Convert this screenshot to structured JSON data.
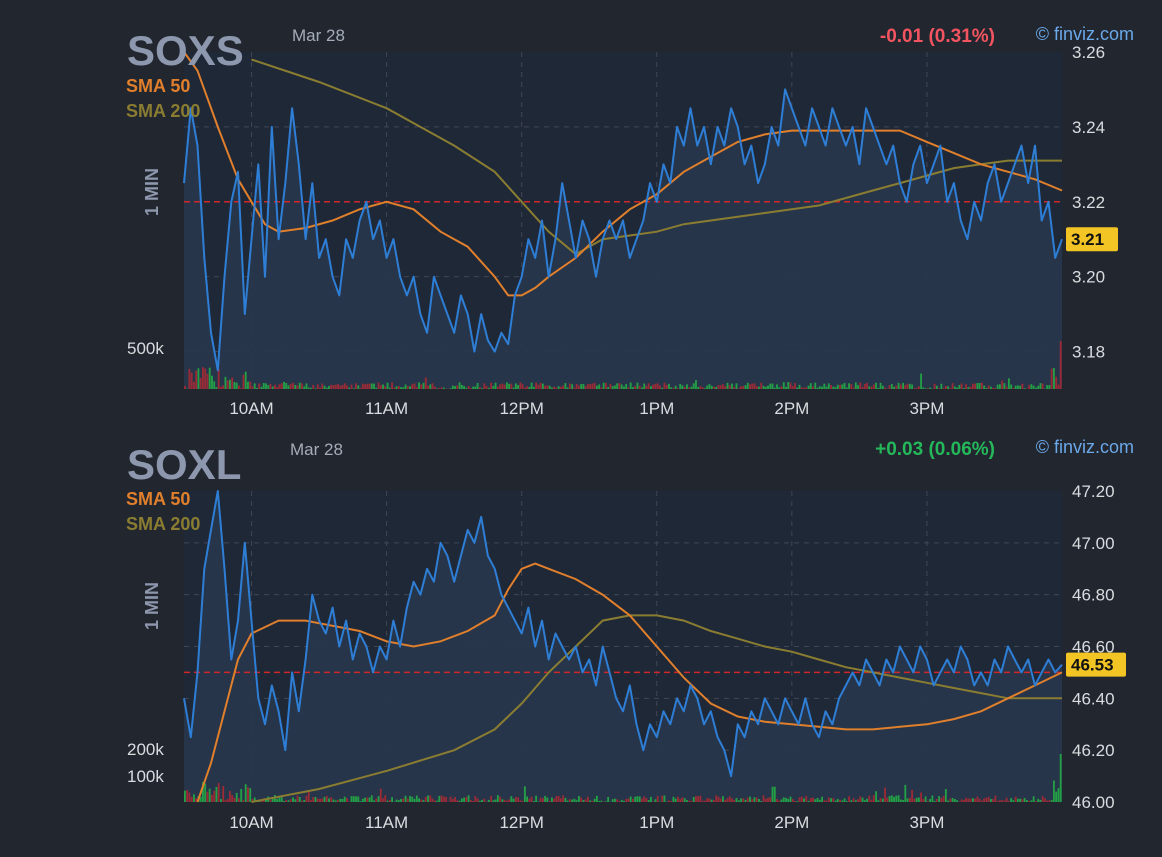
{
  "watermark": "© finviz.com",
  "colors": {
    "background": "#22262f",
    "plot_bg": "#1f2837",
    "price_line": "#2e7ed6",
    "price_fill": "#27364b",
    "sma50": "#e07f2c",
    "sma200": "#8a7d32",
    "prev_close": "#d0282a",
    "grid": "#414654",
    "axis_text": "#d9dcdf",
    "ticker_text": "#8d97ad",
    "vol_up": "#23a046",
    "vol_down": "#9a2b36",
    "change_down": "#f25460",
    "change_up": "#24b85a",
    "last_badge": "#f3c524"
  },
  "chart_data": [
    {
      "type": "line",
      "ticker": "SOXS",
      "date": "Mar 28",
      "timeframe": "1 MIN",
      "change": "-0.01 (0.31%)",
      "direction": "down",
      "legend": [
        "SMA 50",
        "SMA 200"
      ],
      "last_price": "3.21",
      "last_value": 3.21,
      "prev_close": 3.22,
      "ylim": [
        3.17,
        3.26
      ],
      "yticks": [
        3.18,
        3.2,
        3.22,
        3.24,
        3.26
      ],
      "ytick_labels": [
        "3.18",
        "3.20",
        "3.22",
        "3.24",
        "3.26"
      ],
      "x_range": [
        9.5,
        16.0
      ],
      "xticks": [
        10,
        11,
        12,
        13,
        14,
        15
      ],
      "xtick_labels": [
        "10AM",
        "11AM",
        "12PM",
        "1PM",
        "2PM",
        "3PM"
      ],
      "volume_label": "500k",
      "volume_label_value": 500,
      "volume_max": 620,
      "series": [
        {
          "name": "Price",
          "x": [
            9.5,
            9.55,
            9.6,
            9.65,
            9.7,
            9.75,
            9.8,
            9.85,
            9.9,
            9.95,
            10.0,
            10.05,
            10.1,
            10.15,
            10.2,
            10.25,
            10.3,
            10.35,
            10.4,
            10.45,
            10.5,
            10.55,
            10.6,
            10.65,
            10.7,
            10.75,
            10.8,
            10.85,
            10.9,
            10.95,
            11.0,
            11.05,
            11.1,
            11.15,
            11.2,
            11.25,
            11.3,
            11.35,
            11.4,
            11.45,
            11.5,
            11.55,
            11.6,
            11.65,
            11.7,
            11.75,
            11.8,
            11.85,
            11.9,
            11.95,
            12.0,
            12.05,
            12.1,
            12.15,
            12.2,
            12.25,
            12.3,
            12.35,
            12.4,
            12.45,
            12.5,
            12.55,
            12.6,
            12.65,
            12.7,
            12.75,
            12.8,
            12.85,
            12.9,
            12.95,
            13.0,
            13.05,
            13.1,
            13.15,
            13.2,
            13.25,
            13.3,
            13.35,
            13.4,
            13.45,
            13.5,
            13.55,
            13.6,
            13.65,
            13.7,
            13.75,
            13.8,
            13.85,
            13.9,
            13.95,
            14.0,
            14.05,
            14.1,
            14.15,
            14.2,
            14.25,
            14.3,
            14.35,
            14.4,
            14.45,
            14.5,
            14.55,
            14.6,
            14.65,
            14.7,
            14.75,
            14.8,
            14.85,
            14.9,
            14.95,
            15.0,
            15.05,
            15.1,
            15.15,
            15.2,
            15.25,
            15.3,
            15.35,
            15.4,
            15.45,
            15.5,
            15.55,
            15.6,
            15.65,
            15.7,
            15.75,
            15.8,
            15.85,
            15.9,
            15.95,
            16.0
          ],
          "values": [
            3.225,
            3.245,
            3.235,
            3.205,
            3.185,
            3.175,
            3.2,
            3.22,
            3.228,
            3.19,
            3.21,
            3.23,
            3.2,
            3.24,
            3.21,
            3.225,
            3.245,
            3.23,
            3.21,
            3.225,
            3.205,
            3.21,
            3.2,
            3.195,
            3.21,
            3.205,
            3.215,
            3.22,
            3.21,
            3.215,
            3.205,
            3.21,
            3.2,
            3.195,
            3.2,
            3.19,
            3.185,
            3.2,
            3.195,
            3.19,
            3.185,
            3.195,
            3.19,
            3.18,
            3.19,
            3.183,
            3.18,
            3.185,
            3.182,
            3.195,
            3.2,
            3.21,
            3.205,
            3.215,
            3.2,
            3.21,
            3.225,
            3.215,
            3.205,
            3.215,
            3.21,
            3.2,
            3.21,
            3.215,
            3.21,
            3.215,
            3.205,
            3.21,
            3.215,
            3.225,
            3.22,
            3.23,
            3.225,
            3.24,
            3.235,
            3.245,
            3.235,
            3.24,
            3.23,
            3.24,
            3.235,
            3.245,
            3.24,
            3.23,
            3.235,
            3.225,
            3.23,
            3.24,
            3.235,
            3.25,
            3.245,
            3.24,
            3.235,
            3.245,
            3.24,
            3.235,
            3.245,
            3.24,
            3.235,
            3.24,
            3.23,
            3.245,
            3.24,
            3.235,
            3.23,
            3.235,
            3.225,
            3.22,
            3.23,
            3.235,
            3.225,
            3.23,
            3.235,
            3.22,
            3.225,
            3.215,
            3.21,
            3.22,
            3.215,
            3.225,
            3.23,
            3.22,
            3.225,
            3.23,
            3.235,
            3.225,
            3.235,
            3.215,
            3.22,
            3.205,
            3.21
          ]
        },
        {
          "name": "SMA 50",
          "x": [
            9.5,
            9.6,
            9.75,
            9.9,
            10.0,
            10.1,
            10.2,
            10.4,
            10.6,
            10.8,
            11.0,
            11.2,
            11.4,
            11.6,
            11.8,
            11.9,
            12.0,
            12.1,
            12.2,
            12.4,
            12.6,
            12.8,
            13.0,
            13.2,
            13.4,
            13.6,
            13.8,
            14.0,
            14.2,
            14.4,
            14.6,
            14.8,
            15.0,
            15.2,
            15.4,
            15.6,
            15.8,
            16.0
          ],
          "values": [
            3.262,
            3.255,
            3.24,
            3.226,
            3.22,
            3.214,
            3.212,
            3.213,
            3.215,
            3.218,
            3.22,
            3.218,
            3.212,
            3.208,
            3.2,
            3.195,
            3.195,
            3.197,
            3.2,
            3.205,
            3.212,
            3.218,
            3.222,
            3.228,
            3.232,
            3.236,
            3.238,
            3.239,
            3.239,
            3.239,
            3.239,
            3.239,
            3.236,
            3.233,
            3.23,
            3.228,
            3.226,
            3.223
          ]
        },
        {
          "name": "SMA 200",
          "x": [
            10.0,
            10.5,
            11.0,
            11.5,
            11.8,
            12.0,
            12.2,
            12.4,
            12.6,
            12.8,
            13.0,
            13.2,
            13.4,
            13.6,
            13.8,
            14.0,
            14.2,
            14.4,
            14.6,
            14.8,
            15.0,
            15.2,
            15.4,
            15.6,
            15.8,
            16.0
          ],
          "values": [
            3.258,
            3.252,
            3.245,
            3.235,
            3.228,
            3.22,
            3.212,
            3.206,
            3.21,
            3.211,
            3.212,
            3.214,
            3.215,
            3.216,
            3.217,
            3.218,
            3.219,
            3.221,
            3.223,
            3.225,
            3.227,
            3.229,
            3.23,
            3.231,
            3.231,
            3.231
          ]
        }
      ]
    },
    {
      "type": "line",
      "ticker": "SOXL",
      "date": "Mar 28",
      "timeframe": "1 MIN",
      "change": "+0.03 (0.06%)",
      "direction": "up",
      "legend": [
        "SMA 50",
        "SMA 200"
      ],
      "last_price": "46.53",
      "last_value": 46.53,
      "prev_close": 46.5,
      "ylim": [
        46.0,
        47.2
      ],
      "yticks": [
        46.0,
        46.2,
        46.4,
        46.6,
        46.8,
        47.0,
        47.2
      ],
      "ytick_labels": [
        "46.00",
        "46.20",
        "46.40",
        "46.60",
        "46.80",
        "47.00",
        "47.20"
      ],
      "x_range": [
        9.5,
        16.0
      ],
      "xticks": [
        10,
        11,
        12,
        13,
        14,
        15
      ],
      "xtick_labels": [
        "10AM",
        "11AM",
        "12PM",
        "1PM",
        "2PM",
        "3PM"
      ],
      "volume_labels": [
        "200k",
        "100k"
      ],
      "volume_label_values": [
        200,
        100
      ],
      "volume_max": 240,
      "series": [
        {
          "name": "Price",
          "x": [
            9.5,
            9.55,
            9.6,
            9.65,
            9.7,
            9.75,
            9.8,
            9.85,
            9.9,
            9.95,
            10.0,
            10.05,
            10.1,
            10.15,
            10.2,
            10.25,
            10.3,
            10.35,
            10.4,
            10.45,
            10.5,
            10.55,
            10.6,
            10.65,
            10.7,
            10.75,
            10.8,
            10.85,
            10.9,
            10.95,
            11.0,
            11.05,
            11.1,
            11.15,
            11.2,
            11.25,
            11.3,
            11.35,
            11.4,
            11.45,
            11.5,
            11.55,
            11.6,
            11.65,
            11.7,
            11.75,
            11.8,
            11.85,
            11.9,
            11.95,
            12.0,
            12.05,
            12.1,
            12.15,
            12.2,
            12.25,
            12.3,
            12.35,
            12.4,
            12.45,
            12.5,
            12.55,
            12.6,
            12.65,
            12.7,
            12.75,
            12.8,
            12.85,
            12.9,
            12.95,
            13.0,
            13.05,
            13.1,
            13.15,
            13.2,
            13.25,
            13.3,
            13.35,
            13.4,
            13.45,
            13.5,
            13.55,
            13.6,
            13.65,
            13.7,
            13.75,
            13.8,
            13.85,
            13.9,
            13.95,
            14.0,
            14.05,
            14.1,
            14.15,
            14.2,
            14.25,
            14.3,
            14.35,
            14.4,
            14.45,
            14.5,
            14.55,
            14.6,
            14.65,
            14.7,
            14.75,
            14.8,
            14.85,
            14.9,
            14.95,
            15.0,
            15.05,
            15.1,
            15.15,
            15.2,
            15.25,
            15.3,
            15.35,
            15.4,
            15.45,
            15.5,
            15.55,
            15.6,
            15.65,
            15.7,
            15.75,
            15.8,
            15.85,
            15.9,
            15.95,
            16.0
          ],
          "values": [
            46.4,
            46.25,
            46.5,
            46.9,
            47.05,
            47.2,
            46.9,
            46.55,
            46.7,
            47.0,
            46.7,
            46.4,
            46.3,
            46.45,
            46.35,
            46.2,
            46.5,
            46.35,
            46.55,
            46.8,
            46.7,
            46.65,
            46.75,
            46.6,
            46.7,
            46.55,
            46.65,
            46.6,
            46.5,
            46.6,
            46.55,
            46.7,
            46.6,
            46.75,
            46.85,
            46.8,
            46.9,
            46.85,
            47.0,
            46.95,
            46.85,
            46.95,
            47.05,
            47.0,
            47.1,
            46.95,
            46.9,
            46.8,
            46.75,
            46.7,
            46.65,
            46.75,
            46.6,
            46.7,
            46.55,
            46.65,
            46.6,
            46.55,
            46.6,
            46.5,
            46.55,
            46.45,
            46.6,
            46.5,
            46.4,
            46.35,
            46.45,
            46.3,
            46.2,
            46.3,
            46.25,
            46.35,
            46.3,
            46.4,
            46.35,
            46.45,
            46.4,
            46.3,
            46.35,
            46.25,
            46.2,
            46.1,
            46.3,
            46.25,
            46.35,
            46.3,
            46.4,
            46.35,
            46.3,
            46.4,
            46.35,
            46.3,
            46.4,
            46.3,
            46.25,
            46.35,
            46.3,
            46.4,
            46.45,
            46.5,
            46.45,
            46.55,
            46.5,
            46.45,
            46.55,
            46.5,
            46.6,
            46.55,
            46.5,
            46.6,
            46.55,
            46.45,
            46.5,
            46.55,
            46.5,
            46.6,
            46.55,
            46.45,
            46.5,
            46.45,
            46.55,
            46.5,
            46.6,
            46.55,
            46.5,
            46.55,
            46.45,
            46.5,
            46.55,
            46.5,
            46.53
          ]
        },
        {
          "name": "SMA 50",
          "x": [
            9.6,
            9.7,
            9.8,
            9.9,
            10.0,
            10.2,
            10.4,
            10.6,
            10.8,
            11.0,
            11.2,
            11.4,
            11.6,
            11.8,
            11.9,
            12.0,
            12.1,
            12.2,
            12.4,
            12.6,
            12.8,
            13.0,
            13.2,
            13.4,
            13.6,
            13.8,
            14.0,
            14.2,
            14.4,
            14.6,
            14.8,
            15.0,
            15.2,
            15.4,
            15.6,
            15.8,
            16.0
          ],
          "values": [
            46.0,
            46.15,
            46.35,
            46.55,
            46.65,
            46.7,
            46.7,
            46.68,
            46.66,
            46.62,
            46.6,
            46.62,
            46.66,
            46.72,
            46.82,
            46.9,
            46.92,
            46.9,
            46.86,
            46.8,
            46.72,
            46.6,
            46.48,
            46.38,
            46.33,
            46.31,
            46.3,
            46.29,
            46.28,
            46.28,
            46.29,
            46.3,
            46.32,
            46.35,
            46.4,
            46.45,
            46.5
          ]
        },
        {
          "name": "SMA 200",
          "x": [
            10.0,
            10.5,
            11.0,
            11.5,
            11.8,
            12.0,
            12.2,
            12.4,
            12.6,
            12.8,
            13.0,
            13.2,
            13.4,
            13.6,
            13.8,
            14.0,
            14.2,
            14.4,
            14.6,
            14.8,
            15.0,
            15.2,
            15.4,
            15.6,
            15.8,
            16.0
          ],
          "values": [
            46.0,
            46.05,
            46.12,
            46.2,
            46.28,
            46.38,
            46.5,
            46.6,
            46.7,
            46.72,
            46.72,
            46.7,
            46.66,
            46.63,
            46.6,
            46.58,
            46.55,
            46.52,
            46.5,
            46.48,
            46.46,
            46.44,
            46.42,
            46.4,
            46.4,
            46.4
          ]
        }
      ]
    }
  ]
}
